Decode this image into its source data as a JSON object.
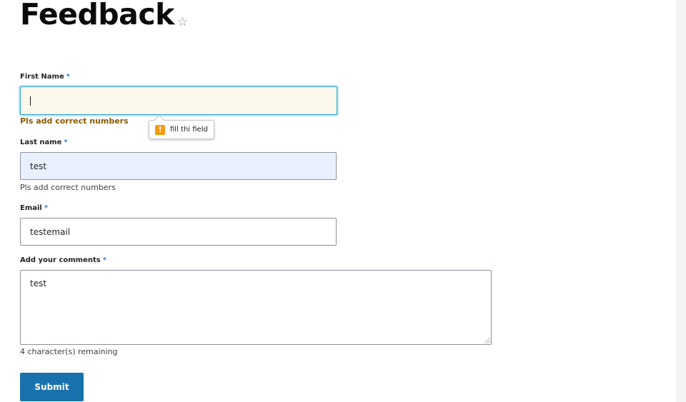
{
  "page": {
    "title": "Feedback"
  },
  "form": {
    "first_name": {
      "label": "First Name",
      "required_mark": "*",
      "value": "",
      "error": "Pls add correct numbers"
    },
    "tooltip": {
      "icon": "warning-icon",
      "icon_glyph": "!",
      "text": "fill thi field",
      "icon_color": "#f39b14"
    },
    "last_name": {
      "label": "Last name",
      "required_mark": "*",
      "value": "test",
      "help": "Pls add correct numbers"
    },
    "email": {
      "label": "Email",
      "required_mark": "*",
      "value": "testemail"
    },
    "comments": {
      "label": "Add your comments",
      "required_mark": "*",
      "value": "test",
      "counter": "4 character(s) remaining"
    },
    "submit_label": "Submit"
  },
  "colors": {
    "accent": "#1a72ad",
    "required": "#3b7bbd",
    "error": "#8a5a00",
    "focus_border": "#26a8cf"
  }
}
